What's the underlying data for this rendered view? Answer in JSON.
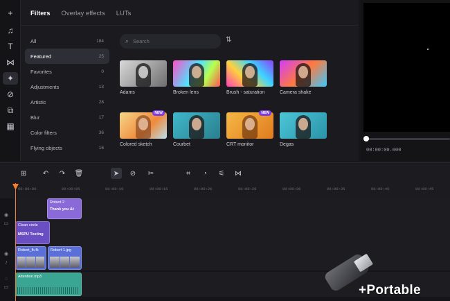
{
  "rail": {
    "items": [
      {
        "icon": "plus-icon",
        "glyph": "+"
      },
      {
        "icon": "music-icon",
        "glyph": "♫"
      },
      {
        "icon": "text-icon",
        "glyph": "T"
      },
      {
        "icon": "transitions-icon",
        "glyph": "⋈"
      },
      {
        "icon": "effects-icon",
        "glyph": "✦"
      },
      {
        "icon": "stickers-icon",
        "glyph": "⊘"
      },
      {
        "icon": "elements-icon",
        "glyph": "⧉"
      },
      {
        "icon": "more-icon",
        "glyph": "▦"
      }
    ]
  },
  "tabs": [
    "Filters",
    "Overlay effects",
    "LUTs"
  ],
  "categories": [
    {
      "label": "All",
      "count": "184"
    },
    {
      "label": "Featured",
      "count": "25"
    },
    {
      "label": "Favorites",
      "count": "0"
    },
    {
      "label": "Adjustments",
      "count": "13"
    },
    {
      "label": "Artistic",
      "count": "28"
    },
    {
      "label": "Blur",
      "count": "17"
    },
    {
      "label": "Color filters",
      "count": "36"
    },
    {
      "label": "Flying objects",
      "count": "16"
    }
  ],
  "search": {
    "placeholder": "Search"
  },
  "filters": [
    {
      "label": "Adams",
      "badge": ""
    },
    {
      "label": "Broken lens",
      "badge": ""
    },
    {
      "label": "Brush - saturation",
      "badge": ""
    },
    {
      "label": "Camera shake",
      "badge": ""
    },
    {
      "label": "Colored sketch",
      "badge": "NEW"
    },
    {
      "label": "Courbet",
      "badge": ""
    },
    {
      "label": "CRT monitor",
      "badge": "NEW"
    },
    {
      "label": "Degas",
      "badge": ""
    }
  ],
  "preview": {
    "time": "00:00:00.000"
  },
  "ruler": {
    "ticks": [
      "00:00:00",
      "00:00:05",
      "00:00:10",
      "00:00:15",
      "00:00:20",
      "00:00:25",
      "00:00:30",
      "00:00:35",
      "00:00:40",
      "00:00:45"
    ]
  },
  "clips": {
    "text1_title": "Robert 2",
    "text1_sub": "Thank you &t",
    "text2_title": "Clean circle",
    "text2_sub": "MSPU Testing",
    "video1": "Robert_fk.fk",
    "video2": "Robert 1.jpg",
    "audio": "Attention.mp3"
  },
  "watermark": {
    "text": "+Portable"
  }
}
